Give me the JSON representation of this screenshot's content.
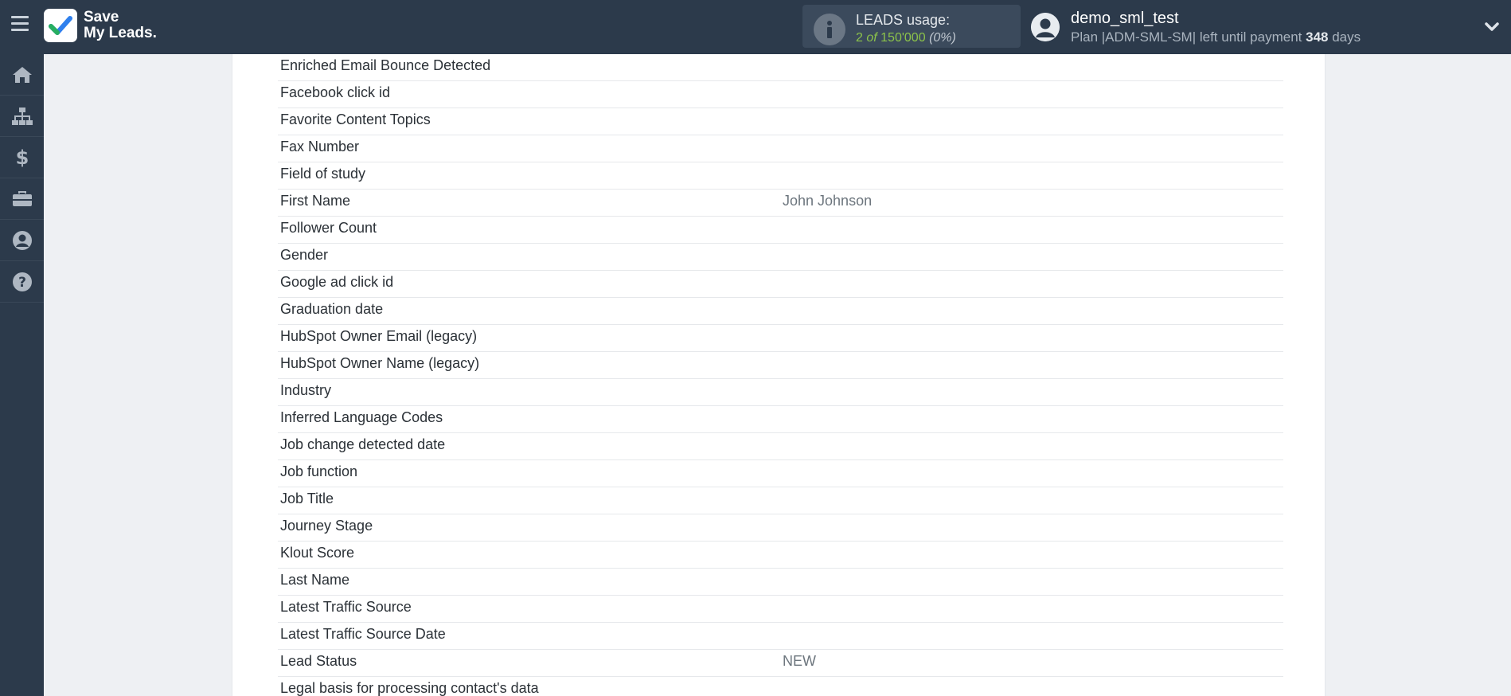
{
  "brand": {
    "line1": "Save",
    "line2": "My Leads."
  },
  "leads_usage": {
    "label": "LEADS usage:",
    "used": "2",
    "of": "of",
    "total": "150'000",
    "percent": "(0%)"
  },
  "user": {
    "name": "demo_sml_test",
    "plan_prefix": "Plan |ADM-SML-SM| left until payment",
    "days_value": "348",
    "days_suffix": "days"
  },
  "sidebar": {
    "items": [
      {
        "icon": "home-icon"
      },
      {
        "icon": "sitemap-icon"
      },
      {
        "icon": "dollar-icon"
      },
      {
        "icon": "briefcase-icon"
      },
      {
        "icon": "user-circle-icon"
      },
      {
        "icon": "question-icon"
      }
    ]
  },
  "fields": [
    {
      "name": "Enriched Email Bounce Detected",
      "value": ""
    },
    {
      "name": "Facebook click id",
      "value": ""
    },
    {
      "name": "Favorite Content Topics",
      "value": ""
    },
    {
      "name": "Fax Number",
      "value": ""
    },
    {
      "name": "Field of study",
      "value": ""
    },
    {
      "name": "First Name",
      "value": "John Johnson"
    },
    {
      "name": "Follower Count",
      "value": ""
    },
    {
      "name": "Gender",
      "value": ""
    },
    {
      "name": "Google ad click id",
      "value": ""
    },
    {
      "name": "Graduation date",
      "value": ""
    },
    {
      "name": "HubSpot Owner Email (legacy)",
      "value": ""
    },
    {
      "name": "HubSpot Owner Name (legacy)",
      "value": ""
    },
    {
      "name": "Industry",
      "value": ""
    },
    {
      "name": "Inferred Language Codes",
      "value": ""
    },
    {
      "name": "Job change detected date",
      "value": ""
    },
    {
      "name": "Job function",
      "value": ""
    },
    {
      "name": "Job Title",
      "value": ""
    },
    {
      "name": "Journey Stage",
      "value": ""
    },
    {
      "name": "Klout Score",
      "value": ""
    },
    {
      "name": "Last Name",
      "value": ""
    },
    {
      "name": "Latest Traffic Source",
      "value": ""
    },
    {
      "name": "Latest Traffic Source Date",
      "value": ""
    },
    {
      "name": "Lead Status",
      "value": "NEW"
    },
    {
      "name": "Legal basis for processing contact's data",
      "value": ""
    }
  ]
}
